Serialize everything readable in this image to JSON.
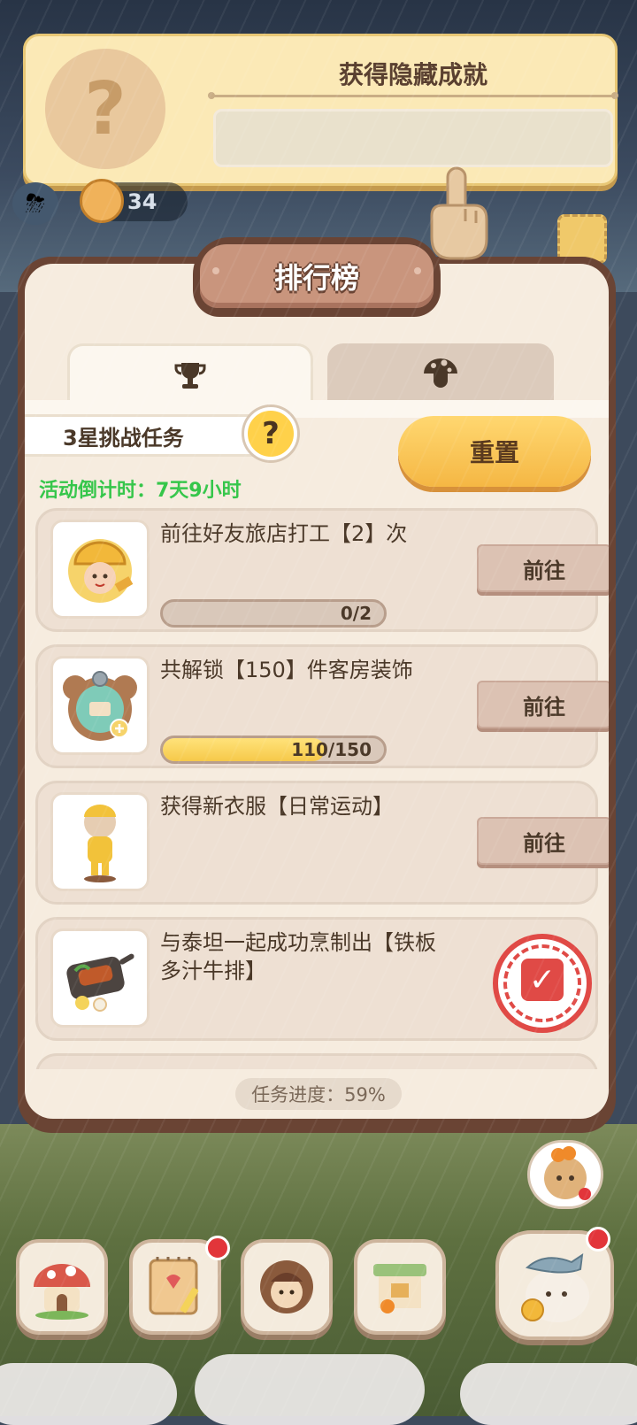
{
  "achievement_toast": {
    "title": "获得隐藏成就",
    "badge_symbol": "?",
    "description": ""
  },
  "hud": {
    "weather_icon": "storm-cloud-icon",
    "cat_count": "34"
  },
  "panel": {
    "title": "排行榜",
    "tabs": [
      {
        "icon": "trophy-icon",
        "active": true
      },
      {
        "icon": "mushroom-icon",
        "active": false
      }
    ],
    "challenge_title": "3星挑战任务",
    "help_label": "?",
    "countdown": "活动倒计时：7天9小时",
    "reset_label": "重置",
    "tasks": [
      {
        "text": "前往好友旅店打工【2】次",
        "button": "前往",
        "progress_text": "0/2",
        "progress": 0.0,
        "icon": "hardhat-worker-icon"
      },
      {
        "text": "共解锁【150】件客房装饰",
        "button": "前往",
        "progress_text": "110/150",
        "progress": 0.733,
        "icon": "decoration-badge-icon"
      },
      {
        "text": "获得新衣服【日常运动】",
        "button": "前往",
        "icon": "outfit-figure-icon"
      },
      {
        "text": "与泰坦一起成功烹制出【铁板多汁牛排】",
        "completed": true,
        "icon": "steak-plate-icon"
      }
    ],
    "overall_progress": "任务进度：59%"
  },
  "bottom_nav": [
    {
      "name": "house",
      "icon": "mushroom-house-icon",
      "badge": false
    },
    {
      "name": "notebook",
      "icon": "notebook-icon",
      "badge": true
    },
    {
      "name": "character",
      "icon": "character-avatar-icon",
      "badge": false
    },
    {
      "name": "shop",
      "icon": "shop-stall-icon",
      "badge": false
    },
    {
      "name": "fish",
      "icon": "fish-character-icon",
      "badge": true
    }
  ],
  "colors": {
    "accent_green": "#35c64a",
    "reset_yellow": "#f5b744",
    "panel_brown": "#6a4434",
    "stamp_red": "#e04a46"
  }
}
